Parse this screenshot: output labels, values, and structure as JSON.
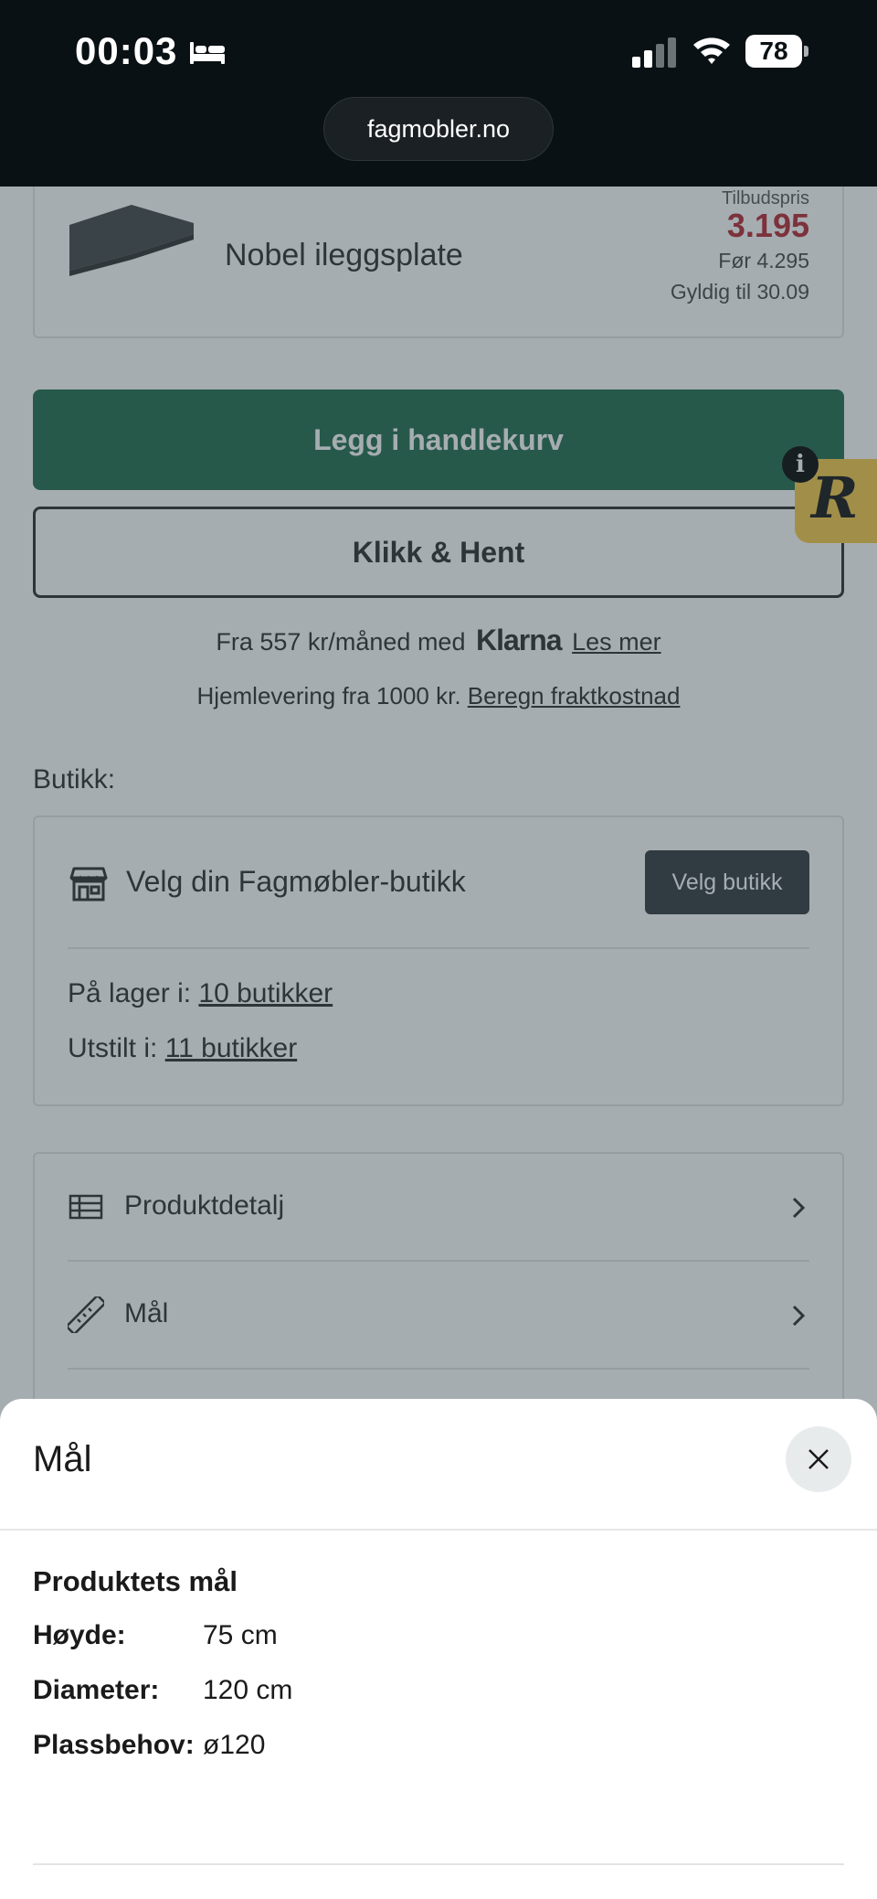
{
  "status_bar": {
    "time": "00:03",
    "battery": "78",
    "url": "fagmobler.no"
  },
  "product": {
    "offer_label": "Tilbudspris",
    "name": "Nobel ileggsplate",
    "price": "3.195",
    "before": "Før 4.295",
    "valid": "Gyldig til 30.09",
    "price_color": "#b4252f"
  },
  "actions": {
    "add_to_cart": "Legg i handlekurv",
    "click_collect": "Klikk & Hent",
    "primary_color": "#1e6a49"
  },
  "financing": {
    "prefix": "Fra 557 kr/måned med",
    "brand": "Klarna",
    "link": "Les mer"
  },
  "delivery": {
    "text": "Hjemlevering fra 1000 kr.",
    "link": "Beregn fraktkostnad"
  },
  "badge": {
    "letter": "R",
    "info": "i"
  },
  "store": {
    "section_label": "Butikk:",
    "title": "Velg din Fagmøbler-butikk",
    "button": "Velg butikk",
    "stock_label": "På lager i:",
    "stock_link": "10 butikker",
    "display_label": "Utstilt i:",
    "display_link": "11 butikker"
  },
  "details": {
    "items": [
      {
        "label": "Produktdetalj",
        "icon": "table-icon"
      },
      {
        "label": "Mål",
        "icon": "ruler-icon"
      }
    ]
  },
  "sheet": {
    "title": "Mål",
    "heading": "Produktets mål",
    "rows": [
      {
        "key": "Høyde:",
        "value": "75 cm"
      },
      {
        "key": "Diameter:",
        "value": "120 cm"
      },
      {
        "key": "Plassbehov:",
        "value": "ø120"
      }
    ]
  }
}
